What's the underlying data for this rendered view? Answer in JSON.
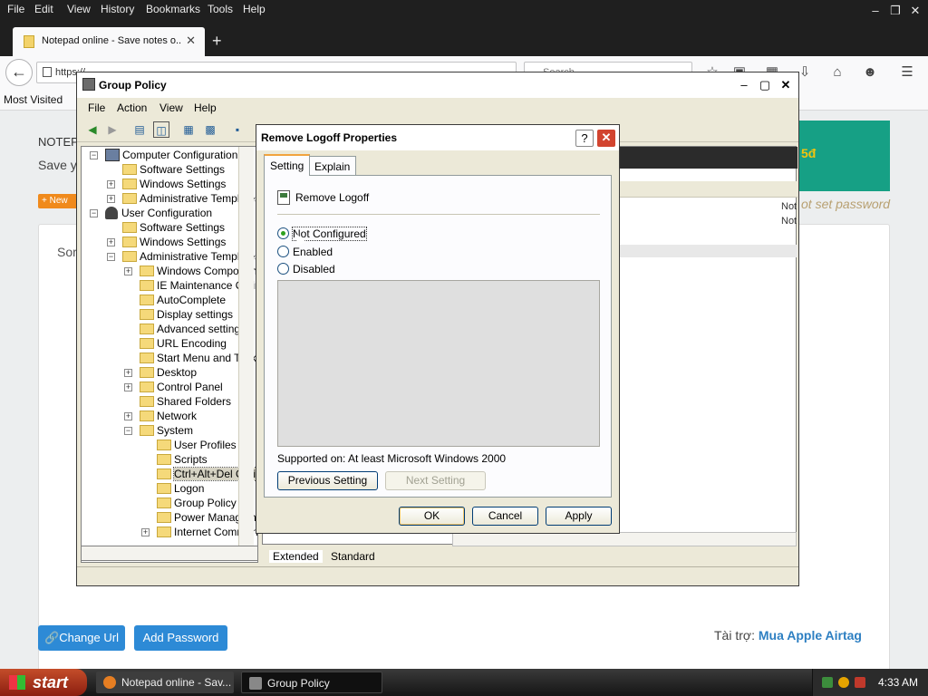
{
  "browser": {
    "menu": [
      "File",
      "Edit",
      "View",
      "History",
      "Bookmarks",
      "Tools",
      "Help"
    ],
    "tab_title": "Notepad online - Save notes o...",
    "url": "https://...",
    "search_placeholder": "Search",
    "bookmark": "Most Visited"
  },
  "page": {
    "brand": "NOTEP",
    "subtitle": "Save y",
    "new_badge": "+ New",
    "green_text": "5đ",
    "not_set_password": "ot set password",
    "card_text": "Sor",
    "change_url": "Change Url",
    "add_password": "Add Password",
    "sponsor_label": "Tài trợ:",
    "sponsor_link": "Mua Apple Airtag"
  },
  "group_policy": {
    "title": "Group Policy",
    "menu": [
      "File",
      "Action",
      "View",
      "Help"
    ],
    "tree": [
      "Computer Configuration",
      "Software Settings",
      "Windows Settings",
      "Administrative Templates",
      "User Configuration",
      "Software Settings",
      "Windows Settings",
      "Administrative Templates",
      "Windows Components",
      "IE Maintenance Online",
      "AutoComplete",
      "Display settings",
      "Advanced settings",
      "URL Encoding",
      "Start Menu and Taskbar",
      "Desktop",
      "Control Panel",
      "Shared Folders",
      "Network",
      "System",
      "User Profiles",
      "Scripts",
      "Ctrl+Alt+Del Options",
      "Logon",
      "Group Policy",
      "Power Management",
      "Internet Communication"
    ],
    "not_conf_1": "Not",
    "not_conf_2": "Not",
    "tab_extended": "Extended",
    "tab_standard": "Standard"
  },
  "dialog": {
    "title": "Remove Logoff Properties",
    "tab_setting": "Setting",
    "tab_explain": "Explain",
    "policy_name": "Remove Logoff",
    "options": [
      "Not Configured",
      "Enabled",
      "Disabled"
    ],
    "selected_option": "Not Configured",
    "supported_label": "Supported on:",
    "supported_value": "At least Microsoft Windows 2000",
    "prev_button": "Previous Setting",
    "next_button": "Next Setting",
    "ok_button": "OK",
    "cancel_button": "Cancel",
    "apply_button": "Apply"
  },
  "taskbar": {
    "start": "start",
    "task1": "Notepad online - Sav...",
    "task2": "Group Policy",
    "time": "4:33 AM"
  },
  "colors": {
    "firefox_dark": "#1f1f1f",
    "page_button_blue": "#2d8ad6",
    "xp_face": "#ece9d8",
    "close_red": "#d2442f",
    "green_panel": "#16a085"
  }
}
